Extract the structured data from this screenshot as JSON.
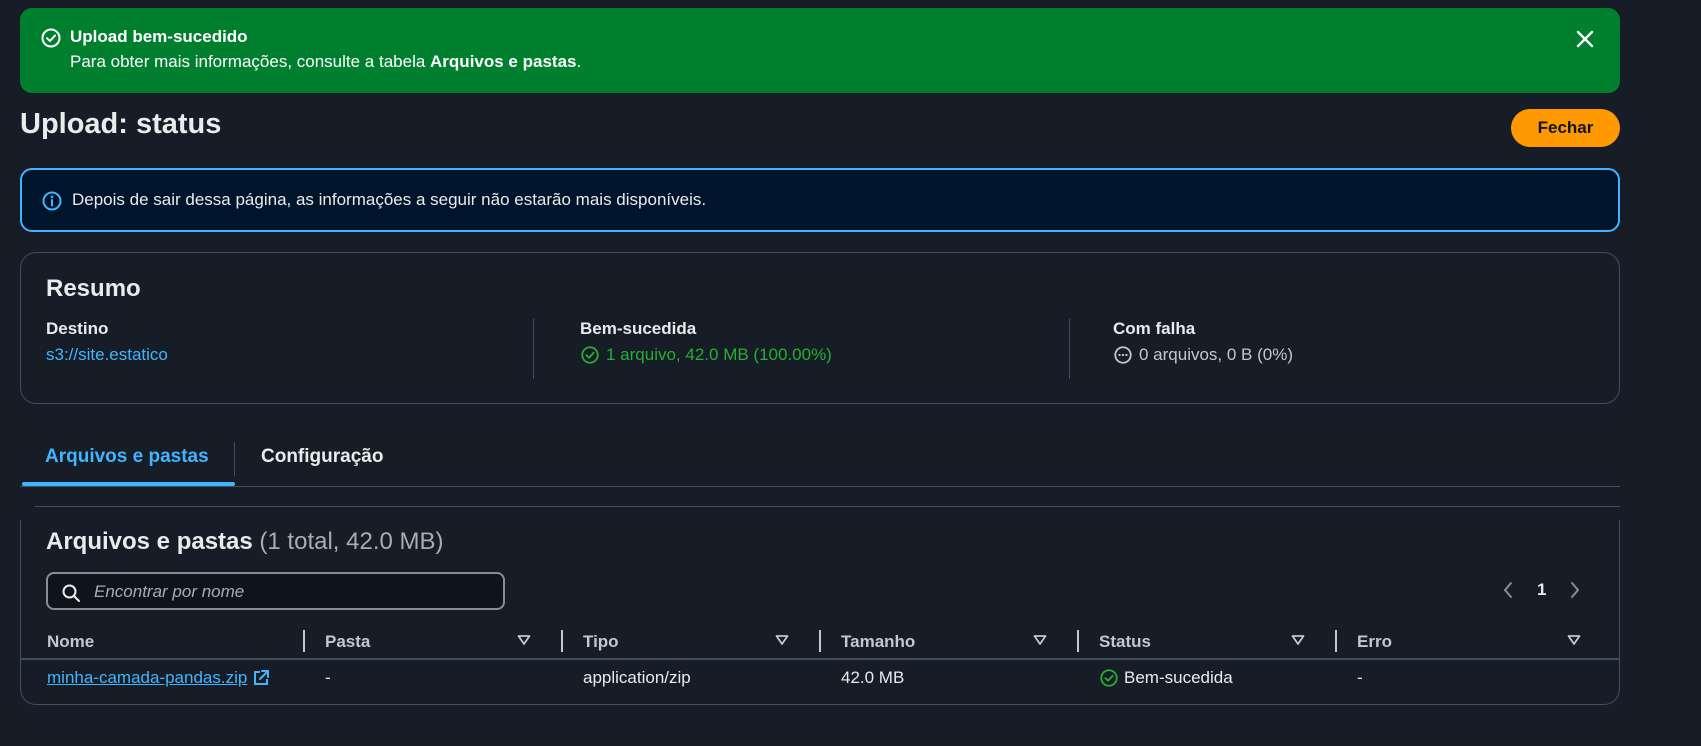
{
  "flash": {
    "title": "Upload bem-sucedido",
    "message_prefix": "Para obter mais informações, consulte a tabela ",
    "message_bold": "Arquivos e pastas",
    "message_suffix": "."
  },
  "page": {
    "title": "Upload: status",
    "close_button": "Fechar"
  },
  "info": {
    "text": "Depois de sair dessa página, as informações a seguir não estarão mais disponíveis."
  },
  "summary": {
    "title": "Resumo",
    "destination_label": "Destino",
    "destination_value": "s3://site.estatico",
    "success_label": "Bem-sucedida",
    "success_value": "1 arquivo, 42.0 MB (100.00%)",
    "failed_label": "Com falha",
    "failed_value": "0 arquivos, 0 B (0%)"
  },
  "tabs": [
    {
      "label": "Arquivos e pastas",
      "active": true
    },
    {
      "label": "Configuração",
      "active": false
    }
  ],
  "files": {
    "title": "Arquivos e pastas",
    "count": "(1 total, 42.0 MB)",
    "search_placeholder": "Encontrar por nome",
    "page_number": "1",
    "columns": [
      "Nome",
      "Pasta",
      "Tipo",
      "Tamanho",
      "Status",
      "Erro"
    ],
    "rows": [
      {
        "name": "minha-camada-pandas.zip",
        "folder": "-",
        "type": "application/zip",
        "size": "42.0 MB",
        "status": "Bem-sucedida",
        "error": "-"
      }
    ]
  },
  "colors": {
    "success_flash": "#00802f",
    "accent_link": "#42b4ff",
    "primary_button": "#ff9900",
    "success_text": "#29ad32",
    "background": "#161d26"
  },
  "icons": {
    "flash": "check-circle-icon",
    "close": "close-icon",
    "info": "info-circle-icon",
    "success": "check-circle-icon",
    "failed": "ellipsis-circle-icon",
    "search": "search-icon",
    "external": "external-link-icon",
    "sort": "sort-down-icon",
    "prev": "chevron-left-icon",
    "next": "chevron-right-icon"
  }
}
